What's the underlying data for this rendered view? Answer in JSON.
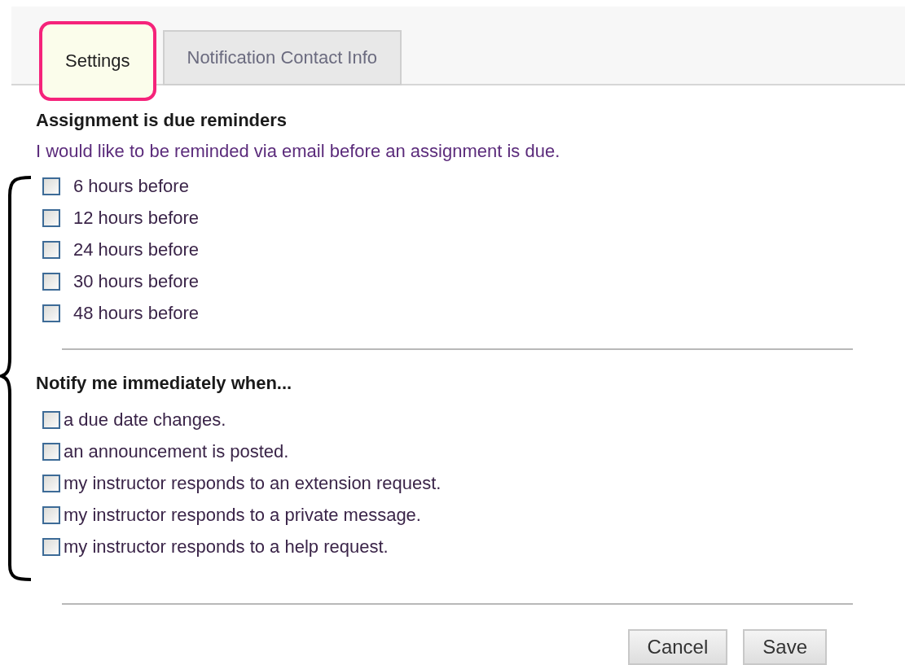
{
  "tabs": [
    {
      "label": "Settings",
      "selected": true,
      "highlighted": true
    },
    {
      "label": "Notification Contact Info",
      "selected": false,
      "highlighted": false
    }
  ],
  "sections": [
    {
      "heading": "Assignment is due reminders",
      "description": "I would like to be reminded via email before an assignment is due.",
      "options": [
        {
          "label": "6 hours before",
          "checked": false
        },
        {
          "label": "12 hours before",
          "checked": false
        },
        {
          "label": "24 hours before",
          "checked": false
        },
        {
          "label": "30 hours before",
          "checked": false
        },
        {
          "label": "48 hours before",
          "checked": false
        }
      ]
    },
    {
      "heading": "Notify me immediately when...",
      "options": [
        {
          "label": "a due date changes.",
          "checked": false
        },
        {
          "label": "an announcement is posted.",
          "checked": false
        },
        {
          "label": "my instructor responds to an extension request.",
          "checked": false
        },
        {
          "label": "my instructor responds to a private message.",
          "checked": false
        },
        {
          "label": "my instructor responds to a help request.",
          "checked": false
        }
      ]
    }
  ],
  "buttons": [
    "Cancel",
    "Save"
  ]
}
